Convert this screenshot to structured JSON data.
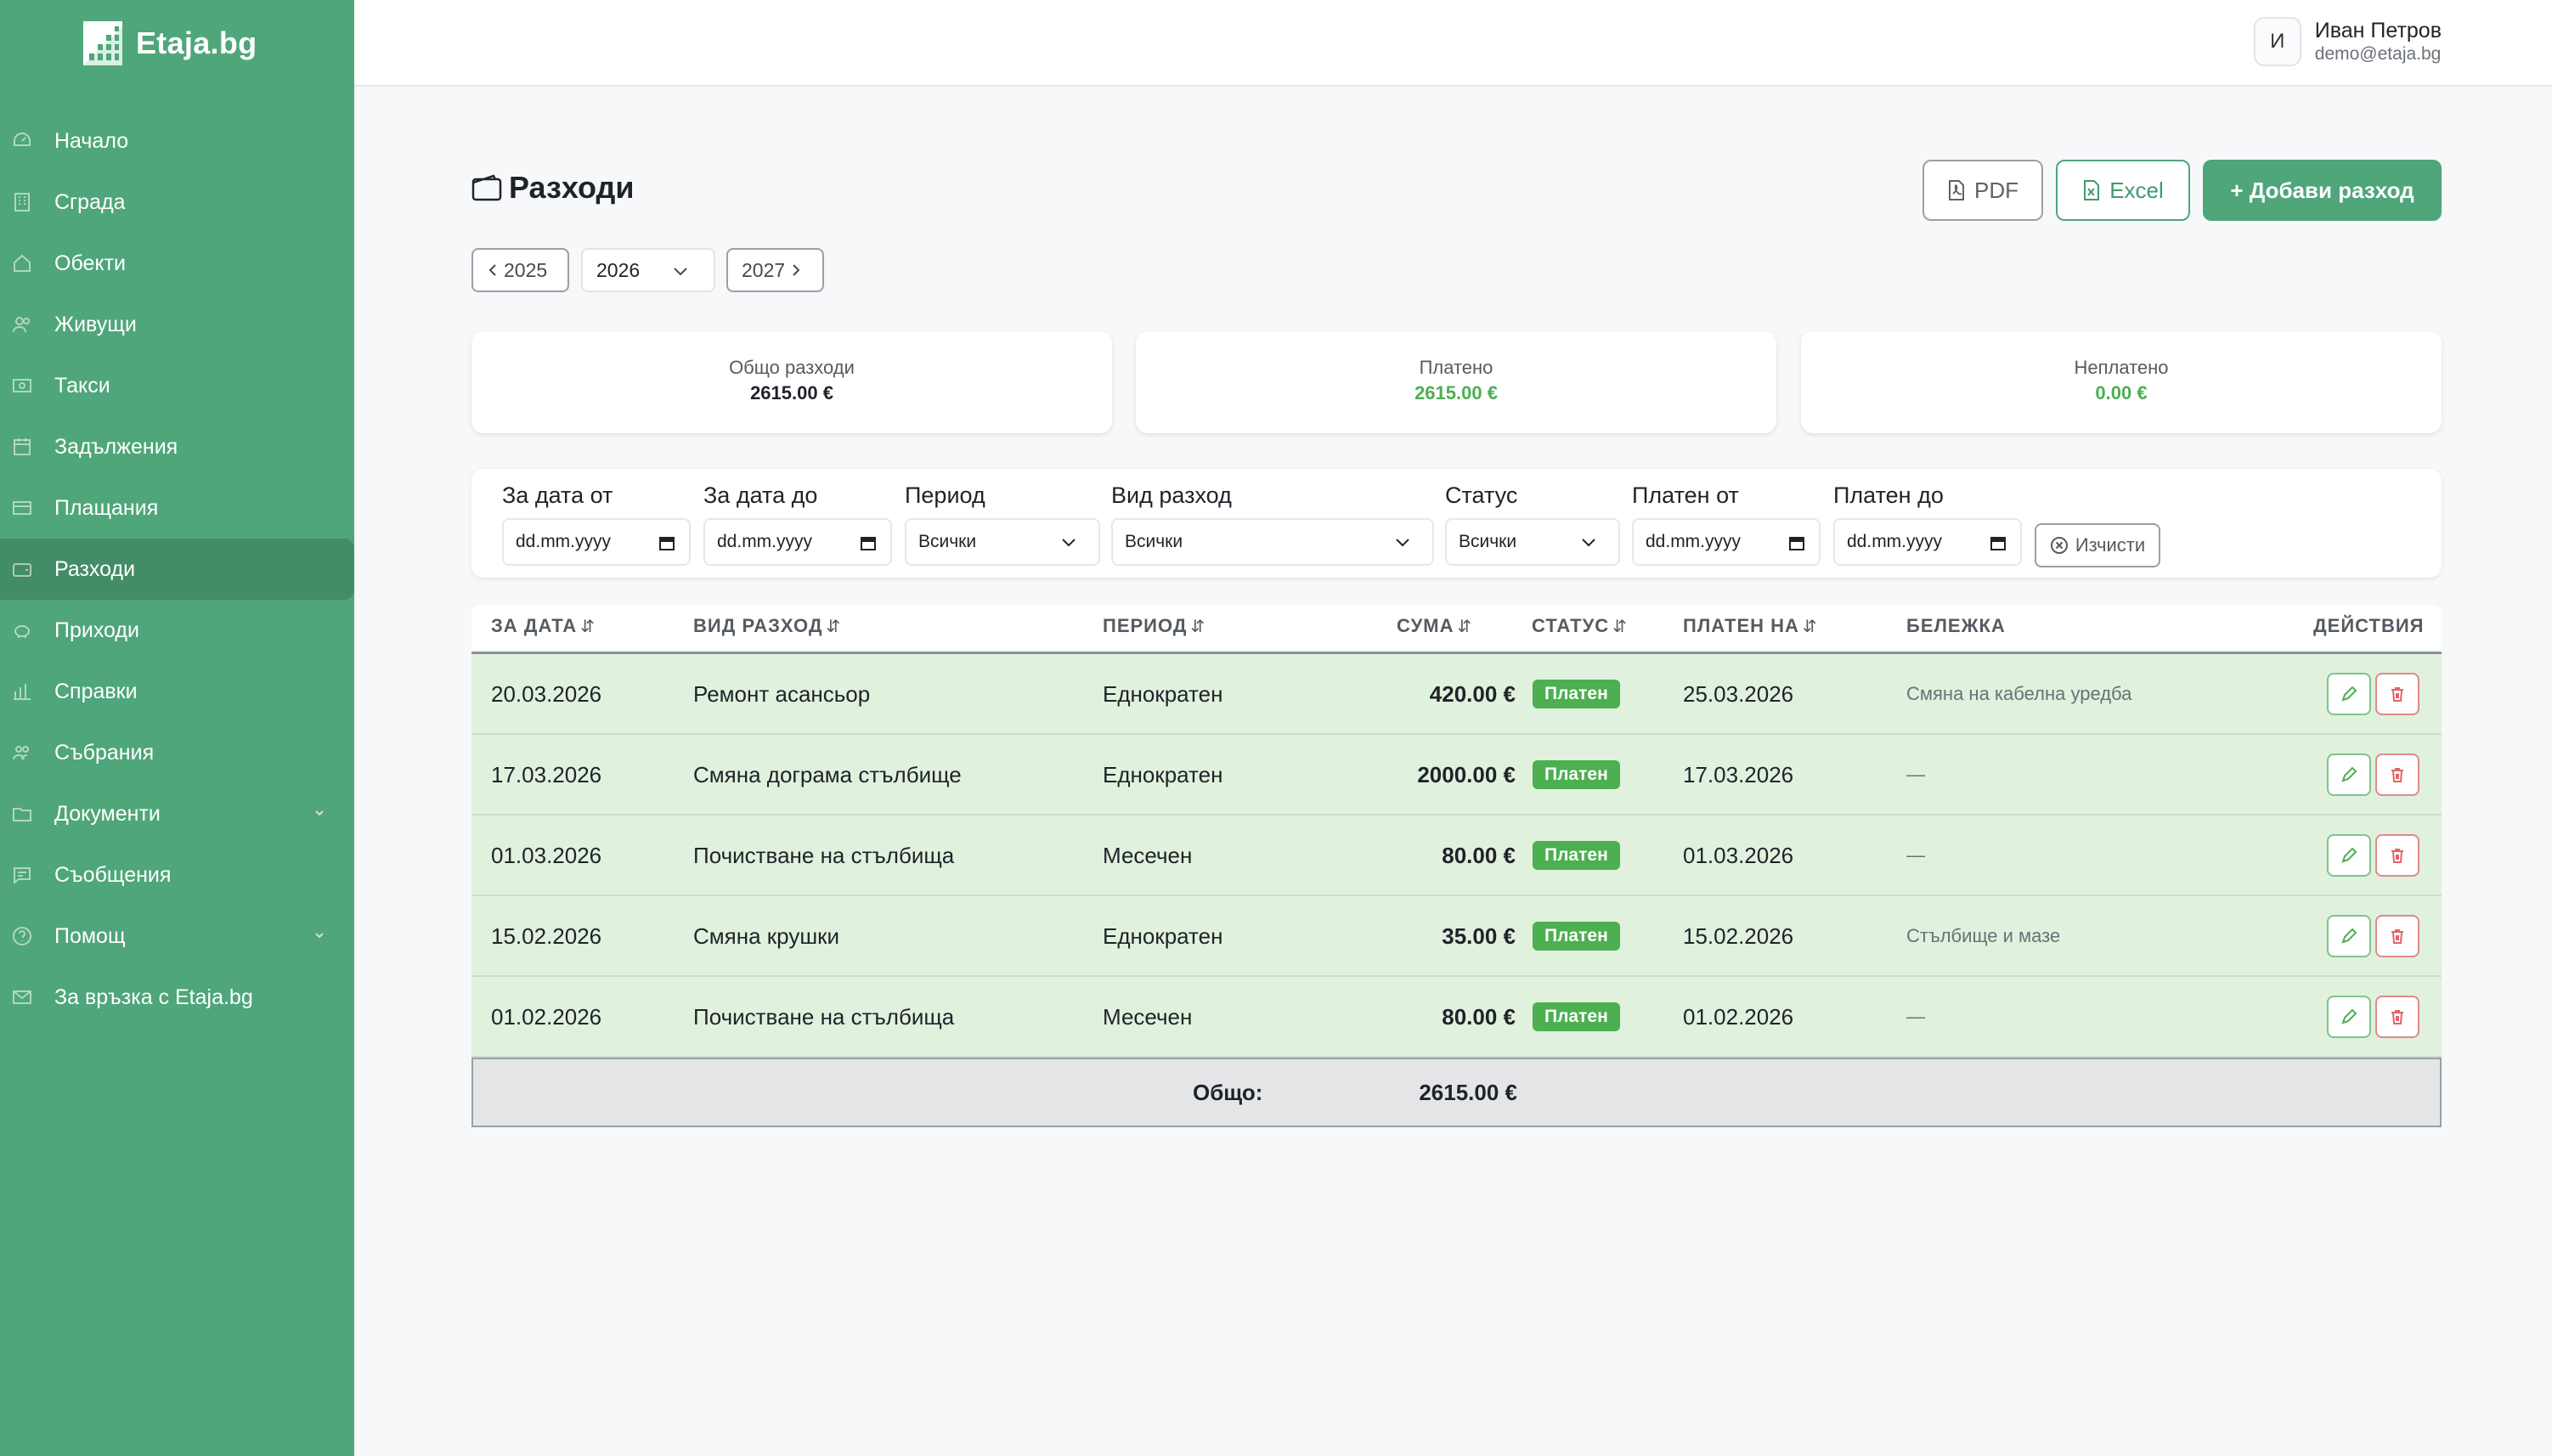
{
  "app": {
    "brand": "Etaja.bg"
  },
  "colors": {
    "primary": "#4fa67a",
    "primary_dark": "#428c66",
    "row_paid": "#e0f1dd",
    "badge_paid": "#4caf50",
    "delete": "#e08a8a"
  },
  "sidebar": {
    "items": [
      {
        "label": "Начало",
        "icon": "dashboard-icon"
      },
      {
        "label": "Сграда",
        "icon": "building-icon"
      },
      {
        "label": "Обекти",
        "icon": "home-icon"
      },
      {
        "label": "Живущи",
        "icon": "users-icon"
      },
      {
        "label": "Такси",
        "icon": "cash-icon"
      },
      {
        "label": "Задължения",
        "icon": "calendar-icon"
      },
      {
        "label": "Плащания",
        "icon": "credit-card-icon"
      },
      {
        "label": "Разходи",
        "icon": "wallet-icon",
        "active": true
      },
      {
        "label": "Приходи",
        "icon": "piggy-bank-icon"
      },
      {
        "label": "Справки",
        "icon": "bar-chart-icon"
      },
      {
        "label": "Събрания",
        "icon": "people-icon"
      },
      {
        "label": "Документи",
        "icon": "folder-icon",
        "has_submenu": true
      },
      {
        "label": "Съобщения",
        "icon": "message-icon"
      },
      {
        "label": "Помощ",
        "icon": "help-icon",
        "has_submenu": true
      },
      {
        "label": "За връзка с Etaja.bg",
        "icon": "mail-icon"
      }
    ]
  },
  "header": {
    "avatar_initial": "И",
    "user_name": "Иван Петров",
    "user_email": "demo@etaja.bg"
  },
  "page": {
    "title": "Разходи",
    "buttons": {
      "pdf": "PDF",
      "excel": "Excel",
      "add": "+ Добави разход"
    }
  },
  "year_selector": {
    "prev": "2025",
    "current": "2026",
    "next": "2027"
  },
  "summary": [
    {
      "label": "Общо разходи",
      "value": "2615.00 €"
    },
    {
      "label": "Платено",
      "value": "2615.00 €"
    },
    {
      "label": "Неплатено",
      "value": "0.00 €"
    }
  ],
  "filters": {
    "date_from": {
      "label": "За дата от",
      "placeholder": "dd.mm.yyyy"
    },
    "date_to": {
      "label": "За дата до",
      "placeholder": "dd.mm.yyyy"
    },
    "period": {
      "label": "Период",
      "value": "Всички"
    },
    "expense_type": {
      "label": "Вид разход",
      "value": "Всички"
    },
    "status": {
      "label": "Статус",
      "value": "Всички"
    },
    "paid_from": {
      "label": "Платен от",
      "placeholder": "dd.mm.yyyy"
    },
    "paid_to": {
      "label": "Платен до",
      "placeholder": "dd.mm.yyyy"
    },
    "clear": "Изчисти"
  },
  "table": {
    "columns": [
      "ЗА ДАТА",
      "ВИД РАЗХОД",
      "ПЕРИОД",
      "СУМА",
      "СТАТУС",
      "ПЛАТЕН НА",
      "БЕЛЕЖКА",
      "ДЕЙСТВИЯ"
    ],
    "rows": [
      {
        "date": "20.03.2026",
        "type": "Ремонт асансьор",
        "period": "Еднократен",
        "amount": "420.00 €",
        "status": "Платен",
        "paid_on": "25.03.2026",
        "note": "Смяна на кабелна уредба"
      },
      {
        "date": "17.03.2026",
        "type": "Смяна дограма стълбище",
        "period": "Еднократен",
        "amount": "2000.00 €",
        "status": "Платен",
        "paid_on": "17.03.2026",
        "note": "—"
      },
      {
        "date": "01.03.2026",
        "type": "Почистване на стълбища",
        "period": "Месечен",
        "amount": "80.00 €",
        "status": "Платен",
        "paid_on": "01.03.2026",
        "note": "—"
      },
      {
        "date": "15.02.2026",
        "type": "Смяна крушки",
        "period": "Еднократен",
        "amount": "35.00 €",
        "status": "Платен",
        "paid_on": "15.02.2026",
        "note": "Стълбище и мазе"
      },
      {
        "date": "01.02.2026",
        "type": "Почистване на стълбища",
        "period": "Месечен",
        "amount": "80.00 €",
        "status": "Платен",
        "paid_on": "01.02.2026",
        "note": "—"
      }
    ],
    "footer": {
      "label": "Общо:",
      "total": "2615.00 €"
    }
  }
}
